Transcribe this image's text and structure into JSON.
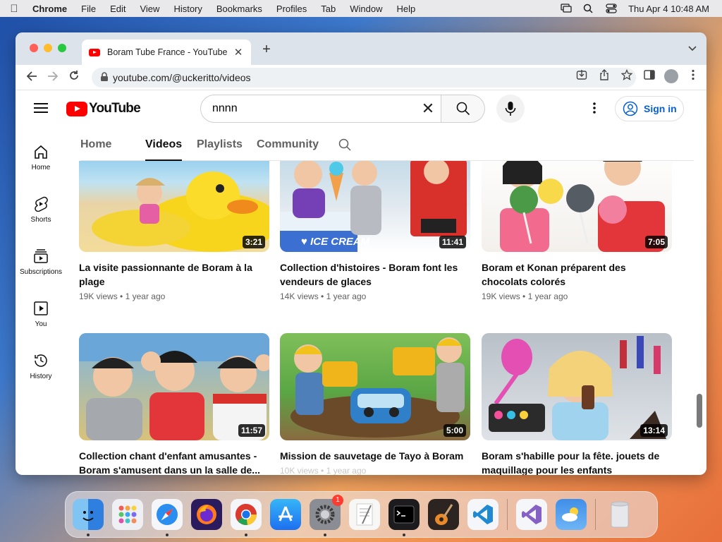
{
  "menubar": {
    "app_name": "Chrome",
    "items": [
      "File",
      "Edit",
      "View",
      "History",
      "Bookmarks",
      "Profiles",
      "Tab",
      "Window",
      "Help"
    ],
    "datetime": "Thu Apr 4  10:48 AM"
  },
  "browser": {
    "tab_title": "Boram Tube France - YouTube",
    "close_glyph": "✕",
    "new_tab_glyph": "+",
    "url": "youtube.com/@uckeritto/videos"
  },
  "youtube": {
    "logo_text": "YouTube",
    "search": {
      "value": "nnnn",
      "clear_glyph": "✕"
    },
    "sign_in_label": "Sign in",
    "sidebar": [
      {
        "label": "Home",
        "icon": "home-icon"
      },
      {
        "label": "Shorts",
        "icon": "shorts-icon"
      },
      {
        "label": "Subscriptions",
        "icon": "subscriptions-icon"
      },
      {
        "label": "You",
        "icon": "you-icon"
      },
      {
        "label": "History",
        "icon": "history-icon"
      }
    ],
    "channel_tabs": [
      {
        "label": "Home",
        "active": false
      },
      {
        "label": "Videos",
        "active": true
      },
      {
        "label": "Playlists",
        "active": false
      },
      {
        "label": "Community",
        "active": false
      }
    ],
    "videos": [
      {
        "title": "La visite passionnante de Boram à la plage",
        "views": "19K views",
        "age": "1 year ago",
        "duration": "3:21"
      },
      {
        "title": "Collection d'histoires - Boram font les vendeurs de glaces",
        "views": "14K views",
        "age": "1 year ago",
        "duration": "11:41"
      },
      {
        "title": "Boram et Konan préparent des chocolats colorés",
        "views": "19K views",
        "age": "1 year ago",
        "duration": "7:05"
      },
      {
        "title": "Collection chant d'enfant amusantes - Boram s'amusent dans un la salle de...",
        "views": "",
        "age": "",
        "duration": "11:57"
      },
      {
        "title": "Mission de sauvetage de Tayo à Boram",
        "views": "10K views",
        "age": "1 year ago",
        "duration": "5:00"
      },
      {
        "title": "Boram s'habille pour la fête. jouets de maquillage pour les enfants",
        "views": "",
        "age": "",
        "duration": "13:14"
      }
    ],
    "meta_separator": "•"
  },
  "dock": {
    "apps": [
      "finder-icon",
      "launchpad-icon",
      "safari-icon",
      "firefox-icon",
      "chrome-icon",
      "app-store-icon",
      "system-settings-icon",
      "textedit-icon",
      "terminal-icon",
      "garageband-icon",
      "vscode-icon",
      "visual-studio-icon",
      "weather-icon",
      "trash-icon"
    ],
    "settings_badge": "1"
  }
}
